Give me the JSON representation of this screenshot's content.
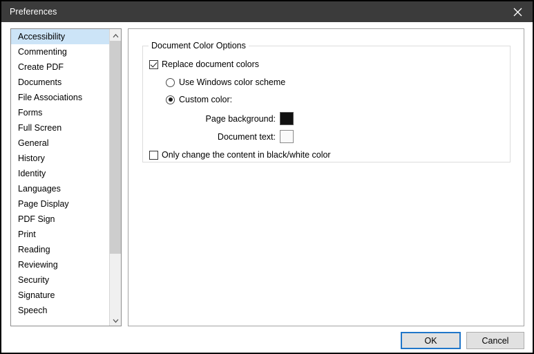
{
  "window": {
    "title": "Preferences",
    "close_icon": "close-icon"
  },
  "sidebar": {
    "items": [
      {
        "label": "Accessibility",
        "selected": true
      },
      {
        "label": "Commenting",
        "selected": false
      },
      {
        "label": "Create PDF",
        "selected": false
      },
      {
        "label": "Documents",
        "selected": false
      },
      {
        "label": "File Associations",
        "selected": false
      },
      {
        "label": "Forms",
        "selected": false
      },
      {
        "label": "Full Screen",
        "selected": false
      },
      {
        "label": "General",
        "selected": false
      },
      {
        "label": "History",
        "selected": false
      },
      {
        "label": "Identity",
        "selected": false
      },
      {
        "label": "Languages",
        "selected": false
      },
      {
        "label": "Page Display",
        "selected": false
      },
      {
        "label": "PDF Sign",
        "selected": false
      },
      {
        "label": "Print",
        "selected": false
      },
      {
        "label": "Reading",
        "selected": false
      },
      {
        "label": "Reviewing",
        "selected": false
      },
      {
        "label": "Security",
        "selected": false
      },
      {
        "label": "Signature",
        "selected": false
      },
      {
        "label": "Speech",
        "selected": false
      }
    ],
    "scroll_up_icon": "chevron-up-icon",
    "scroll_down_icon": "chevron-down-icon"
  },
  "main": {
    "group_title": "Document Color Options",
    "replace_colors": {
      "label": "Replace document colors",
      "checked": true
    },
    "use_windows_scheme": {
      "label": "Use Windows color scheme",
      "selected": false
    },
    "custom_color": {
      "label": "Custom color:",
      "selected": true
    },
    "page_background": {
      "label": "Page background:",
      "color": "#111111"
    },
    "document_text": {
      "label": "Document text:",
      "color": "#fafafa"
    },
    "black_white_only": {
      "label": "Only change the content in black/white color",
      "checked": false
    }
  },
  "footer": {
    "ok_label": "OK",
    "cancel_label": "Cancel"
  },
  "colors": {
    "titlebar_bg": "#3b3b3b",
    "selection_bg": "#cce4f7",
    "focus_border": "#2076c9"
  }
}
